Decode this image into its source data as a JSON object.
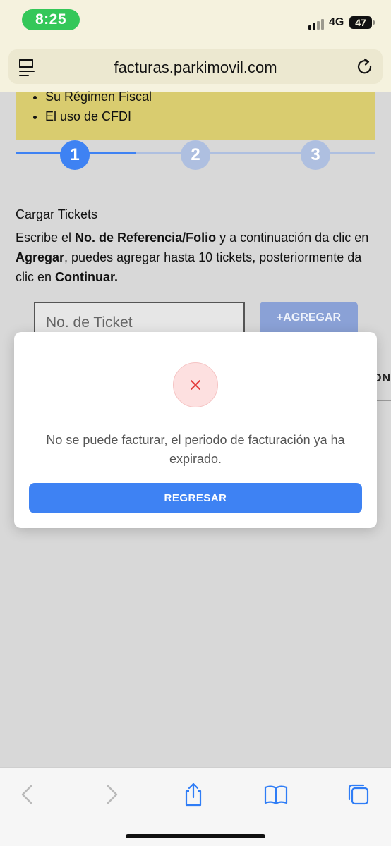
{
  "status_bar": {
    "time": "8:25",
    "network": "4G",
    "battery": "47"
  },
  "browser": {
    "url": "facturas.parkimovil.com"
  },
  "requirements": {
    "items": [
      "Su Régimen Fiscal",
      "El uso de CFDI"
    ]
  },
  "steps": [
    "1",
    "2",
    "3"
  ],
  "colors": {
    "accent": "#3e82f3",
    "step_inactive": "#aebfe0",
    "banner": "#d9cc6f",
    "error_icon": "#e53e3e"
  },
  "content": {
    "section_title": "Cargar Tickets",
    "instructions": {
      "p1": "Escribe el ",
      "b1": "No. de Referencia/Folio",
      "p2": " y a continuación da clic en ",
      "b2": "Agregar",
      "p3": ", puedes agregar hasta 10 tickets, posteriormente da clic en ",
      "b3": "Continuar."
    },
    "ticket_placeholder": "No. de Ticket",
    "add_label": "+AGREGAR",
    "partial_label": "ON"
  },
  "modal": {
    "icon": "close-icon",
    "message": "No se puede facturar, el periodo de facturación ya ha expirado.",
    "button_label": "REGRESAR"
  },
  "toolbar": {
    "icons": [
      "back-icon",
      "forward-icon",
      "share-icon",
      "bookmarks-icon",
      "tabs-icon"
    ]
  }
}
